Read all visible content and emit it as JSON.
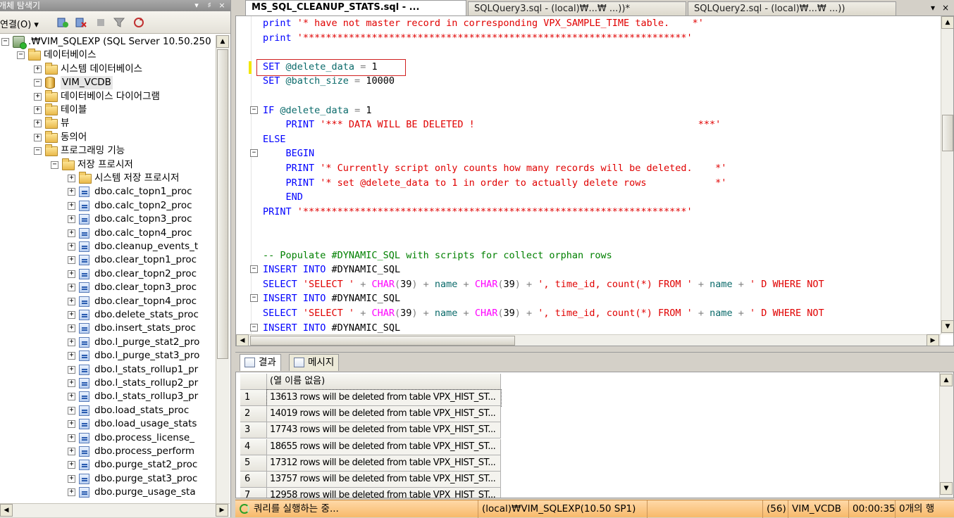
{
  "explorer": {
    "title": "개체 탐색기",
    "title_buttons": [
      "▾",
      "♯",
      "×"
    ],
    "connect_label": "연결(O)",
    "tree": [
      {
        "level": 0,
        "expand": "−",
        "icon": "server",
        "label": ".₩VIM_SQLEXP (SQL Server 10.50.250"
      },
      {
        "level": 1,
        "expand": "−",
        "icon": "folder",
        "label": "데이터베이스"
      },
      {
        "level": 2,
        "expand": "+",
        "icon": "folder",
        "label": "시스템 데이터베이스"
      },
      {
        "level": 2,
        "expand": "−",
        "icon": "database",
        "label": "VIM_VCDB"
      },
      {
        "level": 3,
        "expand": "+",
        "icon": "folder",
        "label": "데이터베이스 다이어그램"
      },
      {
        "level": 3,
        "expand": "+",
        "icon": "folder",
        "label": "테이블"
      },
      {
        "level": 3,
        "expand": "+",
        "icon": "folder",
        "label": "뷰"
      },
      {
        "level": 3,
        "expand": "+",
        "icon": "folder",
        "label": "동의어"
      },
      {
        "level": 3,
        "expand": "−",
        "icon": "folder",
        "label": "프로그래밍 기능"
      },
      {
        "level": 4,
        "expand": "−",
        "icon": "folder",
        "label": "저장 프로시저"
      },
      {
        "level": 5,
        "expand": "+",
        "icon": "folder",
        "label": "시스템 저장 프로시저"
      },
      {
        "level": 5,
        "expand": "+",
        "icon": "proc",
        "label": "dbo.calc_topn1_proc"
      },
      {
        "level": 5,
        "expand": "+",
        "icon": "proc",
        "label": "dbo.calc_topn2_proc"
      },
      {
        "level": 5,
        "expand": "+",
        "icon": "proc",
        "label": "dbo.calc_topn3_proc"
      },
      {
        "level": 5,
        "expand": "+",
        "icon": "proc",
        "label": "dbo.calc_topn4_proc"
      },
      {
        "level": 5,
        "expand": "+",
        "icon": "proc",
        "label": "dbo.cleanup_events_t"
      },
      {
        "level": 5,
        "expand": "+",
        "icon": "proc",
        "label": "dbo.clear_topn1_proc"
      },
      {
        "level": 5,
        "expand": "+",
        "icon": "proc",
        "label": "dbo.clear_topn2_proc"
      },
      {
        "level": 5,
        "expand": "+",
        "icon": "proc",
        "label": "dbo.clear_topn3_proc"
      },
      {
        "level": 5,
        "expand": "+",
        "icon": "proc",
        "label": "dbo.clear_topn4_proc"
      },
      {
        "level": 5,
        "expand": "+",
        "icon": "proc",
        "label": "dbo.delete_stats_proc"
      },
      {
        "level": 5,
        "expand": "+",
        "icon": "proc",
        "label": "dbo.insert_stats_proc"
      },
      {
        "level": 5,
        "expand": "+",
        "icon": "proc",
        "label": "dbo.l_purge_stat2_pro"
      },
      {
        "level": 5,
        "expand": "+",
        "icon": "proc",
        "label": "dbo.l_purge_stat3_pro"
      },
      {
        "level": 5,
        "expand": "+",
        "icon": "proc",
        "label": "dbo.l_stats_rollup1_pr"
      },
      {
        "level": 5,
        "expand": "+",
        "icon": "proc",
        "label": "dbo.l_stats_rollup2_pr"
      },
      {
        "level": 5,
        "expand": "+",
        "icon": "proc",
        "label": "dbo.l_stats_rollup3_pr"
      },
      {
        "level": 5,
        "expand": "+",
        "icon": "proc",
        "label": "dbo.load_stats_proc"
      },
      {
        "level": 5,
        "expand": "+",
        "icon": "proc",
        "label": "dbo.load_usage_stats"
      },
      {
        "level": 5,
        "expand": "+",
        "icon": "proc",
        "label": "dbo.process_license_"
      },
      {
        "level": 5,
        "expand": "+",
        "icon": "proc",
        "label": "dbo.process_perform"
      },
      {
        "level": 5,
        "expand": "+",
        "icon": "proc",
        "label": "dbo.purge_stat2_proc"
      },
      {
        "level": 5,
        "expand": "+",
        "icon": "proc",
        "label": "dbo.purge_stat3_proc"
      },
      {
        "level": 5,
        "expand": "+",
        "icon": "proc",
        "label": "dbo.purge_usage_sta"
      }
    ]
  },
  "tabs": [
    {
      "label": "MS_SQL_CLEANUP_STATS.sql - ...",
      "active": true
    },
    {
      "label": "SQLQuery3.sql - (local)₩...₩     ...))*",
      "active": false
    },
    {
      "label": "SQLQuery2.sql - (local)₩...₩     ...))",
      "active": false
    }
  ],
  "tab_controls": [
    "▾",
    "×"
  ],
  "editor": {
    "lines": [
      {
        "fold": "",
        "parts": [
          [
            "kw",
            "print "
          ],
          [
            "st",
            "'* have not master record in corresponding VPX_SAMPLE_TIME table.    *'"
          ]
        ]
      },
      {
        "fold": "",
        "parts": [
          [
            "kw",
            "print "
          ],
          [
            "st",
            "'*******************************************************************'"
          ]
        ]
      },
      {
        "fold": "",
        "parts": [
          [
            "tx",
            ""
          ]
        ]
      },
      {
        "fold": "",
        "parts": [
          [
            "kw",
            "SET "
          ],
          [
            "vr",
            "@delete_data"
          ],
          [
            "gr",
            " = "
          ],
          [
            "tx",
            "1"
          ]
        ]
      },
      {
        "fold": "",
        "parts": [
          [
            "kw",
            "SET "
          ],
          [
            "vr",
            "@batch_size"
          ],
          [
            "gr",
            " = "
          ],
          [
            "tx",
            "10000"
          ]
        ]
      },
      {
        "fold": "",
        "parts": [
          [
            "tx",
            ""
          ]
        ]
      },
      {
        "fold": "−",
        "parts": [
          [
            "kw",
            "IF "
          ],
          [
            "vr",
            "@delete_data"
          ],
          [
            "gr",
            " = "
          ],
          [
            "tx",
            "1"
          ]
        ]
      },
      {
        "fold": "",
        "parts": [
          [
            "kw",
            "    PRINT "
          ],
          [
            "st",
            "'*** DATA WILL BE DELETED !                                       ***'"
          ]
        ]
      },
      {
        "fold": "",
        "parts": [
          [
            "kw",
            "ELSE"
          ]
        ]
      },
      {
        "fold": "−",
        "parts": [
          [
            "kw",
            "    BEGIN"
          ]
        ]
      },
      {
        "fold": "",
        "parts": [
          [
            "kw",
            "    PRINT "
          ],
          [
            "st",
            "'* Currently script only counts how many records will be deleted.    *'"
          ]
        ]
      },
      {
        "fold": "",
        "parts": [
          [
            "kw",
            "    PRINT "
          ],
          [
            "st",
            "'* set @delete_data to 1 in order to actually delete rows            *'"
          ]
        ]
      },
      {
        "fold": "",
        "parts": [
          [
            "kw",
            "    END"
          ]
        ]
      },
      {
        "fold": "",
        "parts": [
          [
            "kw",
            "PRINT "
          ],
          [
            "st",
            "'*******************************************************************'"
          ]
        ]
      },
      {
        "fold": "",
        "parts": [
          [
            "tx",
            ""
          ]
        ]
      },
      {
        "fold": "",
        "parts": [
          [
            "tx",
            ""
          ]
        ]
      },
      {
        "fold": "",
        "parts": [
          [
            "cm",
            "-- Populate #DYNAMIC_SQL with scripts for collect orphan rows"
          ]
        ]
      },
      {
        "fold": "−",
        "parts": [
          [
            "kw",
            "INSERT INTO "
          ],
          [
            "tx",
            "#DYNAMIC_SQL"
          ]
        ]
      },
      {
        "fold": "",
        "parts": [
          [
            "kw",
            "SELECT "
          ],
          [
            "st",
            "'SELECT '"
          ],
          [
            "gr",
            " + "
          ],
          [
            "fn",
            "CHAR"
          ],
          [
            "gr",
            "("
          ],
          [
            "tx",
            "39"
          ],
          [
            "gr",
            ")"
          ],
          [
            "gr",
            " + "
          ],
          [
            "vr",
            "name"
          ],
          [
            "gr",
            " + "
          ],
          [
            "fn",
            "CHAR"
          ],
          [
            "gr",
            "("
          ],
          [
            "tx",
            "39"
          ],
          [
            "gr",
            ")"
          ],
          [
            "gr",
            " + "
          ],
          [
            "st",
            "', time_id, count(*) FROM '"
          ],
          [
            "gr",
            " + "
          ],
          [
            "vr",
            "name"
          ],
          [
            "gr",
            " + "
          ],
          [
            "st",
            "' D WHERE NOT"
          ]
        ]
      },
      {
        "fold": "−",
        "parts": [
          [
            "kw",
            "INSERT INTO "
          ],
          [
            "tx",
            "#DYNAMIC_SQL"
          ]
        ]
      },
      {
        "fold": "",
        "parts": [
          [
            "kw",
            "SELECT "
          ],
          [
            "st",
            "'SELECT '"
          ],
          [
            "gr",
            " + "
          ],
          [
            "fn",
            "CHAR"
          ],
          [
            "gr",
            "("
          ],
          [
            "tx",
            "39"
          ],
          [
            "gr",
            ")"
          ],
          [
            "gr",
            " + "
          ],
          [
            "vr",
            "name"
          ],
          [
            "gr",
            " + "
          ],
          [
            "fn",
            "CHAR"
          ],
          [
            "gr",
            "("
          ],
          [
            "tx",
            "39"
          ],
          [
            "gr",
            ")"
          ],
          [
            "gr",
            " + "
          ],
          [
            "st",
            "', time_id, count(*) FROM '"
          ],
          [
            "gr",
            " + "
          ],
          [
            "vr",
            "name"
          ],
          [
            "gr",
            " + "
          ],
          [
            "st",
            "' D WHERE NOT"
          ]
        ]
      },
      {
        "fold": "−",
        "parts": [
          [
            "kw",
            "INSERT INTO "
          ],
          [
            "tx",
            "#DYNAMIC_SQL"
          ]
        ]
      }
    ]
  },
  "results": {
    "tabs": [
      {
        "label": "결과",
        "active": true
      },
      {
        "label": "메시지",
        "active": false
      }
    ],
    "column_header": "(열 이름 없음)",
    "rows": [
      {
        "num": "1",
        "value": "13613 rows will be deleted from table VPX_HIST_ST..."
      },
      {
        "num": "2",
        "value": "14019 rows will be deleted from table VPX_HIST_ST..."
      },
      {
        "num": "3",
        "value": "17743 rows will be deleted from table VPX_HIST_ST..."
      },
      {
        "num": "4",
        "value": "18655 rows will be deleted from table VPX_HIST_ST..."
      },
      {
        "num": "5",
        "value": "17312 rows will be deleted from table VPX_HIST_ST..."
      },
      {
        "num": "6",
        "value": "13757 rows will be deleted from table VPX_HIST_ST..."
      },
      {
        "num": "7",
        "value": "12958 rows will be deleted from table VPX_HIST_ST..."
      }
    ]
  },
  "status": {
    "message": "쿼리를 실행하는 중...",
    "server": "(local)₩VIM_SQLEXP(10.50 SP1)",
    "user": "",
    "spid": "(56)",
    "database": "VIM_VCDB",
    "elapsed": "00:00:35",
    "rows": "0개의 행"
  }
}
